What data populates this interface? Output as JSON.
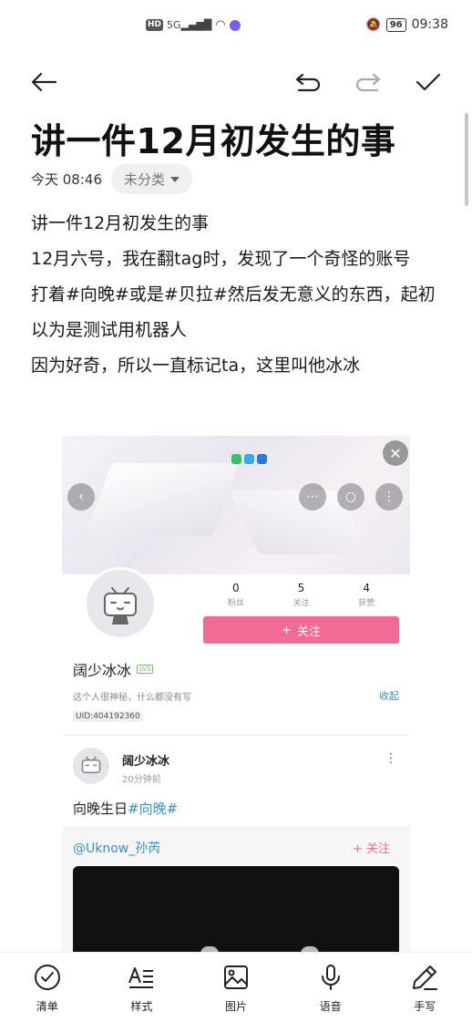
{
  "status_bar": {
    "time": "09:38",
    "battery": "96",
    "network": "5G",
    "hd": "HD"
  },
  "toolbar": {
    "back_icon": "back-arrow-icon",
    "undo_icon": "undo-icon",
    "redo_icon": "redo-icon",
    "done_icon": "check-icon"
  },
  "note": {
    "title": "讲一件12月初发生的事",
    "date": "今天 08:46",
    "category": "未分类",
    "paragraphs": [
      "讲一件12月初发生的事",
      "12月六号，我在翻tag时，发现了一个奇怪的账号",
      "打着#向晚#或是#贝拉#然后发无意义的东西，起初以为是测试用机器人",
      "因为好奇，所以一直标记ta，这里叫他冰冰"
    ]
  },
  "embed": {
    "stats": [
      {
        "num": "0",
        "label": "粉丝"
      },
      {
        "num": "5",
        "label": "关注"
      },
      {
        "num": "4",
        "label": "获赞"
      }
    ],
    "follow_button": "关注",
    "username": "阔少冰冰",
    "level": "LV3",
    "bio": "这个人很神秘，什么都没有写",
    "collapse": "收起",
    "uid": "UID:404192360",
    "post": {
      "name": "阔少冰冰",
      "time": "20分钟前",
      "text_prefix": "向晚生日",
      "tag": "#向晚#"
    },
    "repost": {
      "name": "@Uknow_孙芮",
      "follow": "关注"
    }
  },
  "bottom_nav": [
    {
      "label": "清单",
      "icon": "checklist-icon"
    },
    {
      "label": "样式",
      "icon": "text-style-icon"
    },
    {
      "label": "图片",
      "icon": "image-icon"
    },
    {
      "label": "语音",
      "icon": "microphone-icon"
    },
    {
      "label": "手写",
      "icon": "pen-icon"
    }
  ],
  "colors": {
    "accent_pink": "#f26a96",
    "link_blue": "#3a90c8"
  }
}
